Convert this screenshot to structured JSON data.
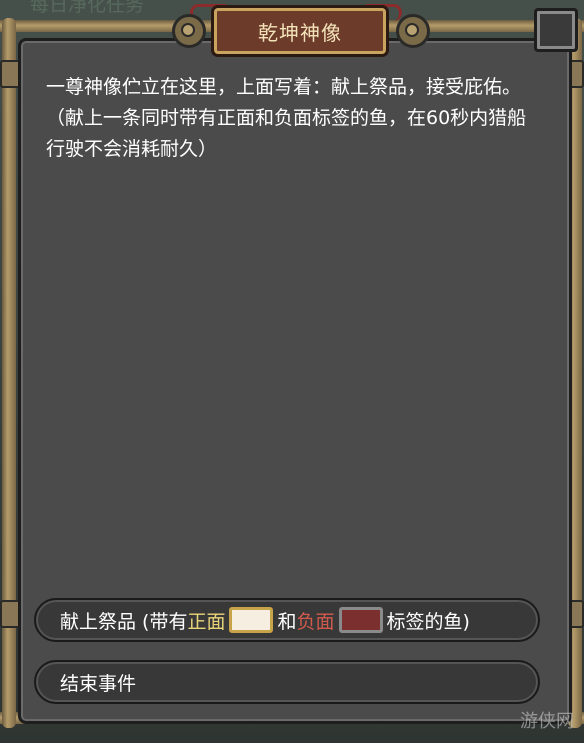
{
  "background": {
    "quest_text": "每日净化任务"
  },
  "event": {
    "title": "乾坤神像",
    "description": "一尊神像伫立在这里，上面写着：献上祭品，接受庇佑。（献上一条同时带有正面和负面标签的鱼，在60秒内猎船行驶不会消耗耐久）"
  },
  "choices": {
    "offer": {
      "prefix": "献上祭品 (带有",
      "positive_label": "正面",
      "middle": "和",
      "negative_label": "负面",
      "suffix": "标签的鱼)"
    },
    "end": {
      "label": "结束事件"
    }
  },
  "watermark": "游侠网",
  "colors": {
    "positive": "#e9d57a",
    "negative": "#d25a4c",
    "title_plate": "#6d3b2a"
  }
}
